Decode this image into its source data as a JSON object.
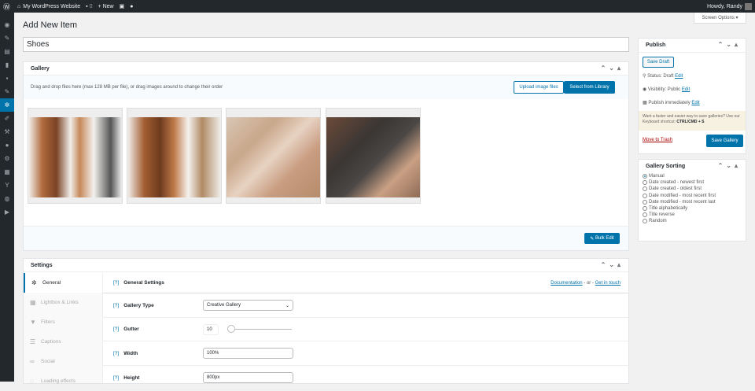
{
  "adminbar": {
    "site_name": "My WordPress Website",
    "comments": "0",
    "new_label": "New",
    "greeting": "Howdy, Randy"
  },
  "screen_options": "Screen Options ▾",
  "page_title": "Add New Item",
  "title_value": "Shoes",
  "gallery": {
    "title": "Gallery",
    "drop_text": "Drag and drop files here (max 128 MB per file), or drag images around to change their order",
    "upload_label": "Upload image files",
    "library_label": "Select from Library",
    "bulk_edit": "Bulk Edit",
    "images": [
      "Brown leather shoes with tools",
      "Brown leather shoes with thread spools",
      "Hands stitching leather",
      "Hands cutting dark leather"
    ]
  },
  "settings": {
    "title": "Settings",
    "tabs": [
      "General",
      "Lightbox & Links",
      "Filters",
      "Captions",
      "Social",
      "Loading effects"
    ],
    "section_title": "General Settings",
    "documentation": "Documentation",
    "or": "- or -",
    "get_in_touch": "Get in touch",
    "help": "[?]",
    "fields": {
      "gallery_type_label": "Gallery Type",
      "gallery_type_value": "Creative Gallery",
      "gutter_label": "Gutter",
      "gutter_value": "10",
      "width_label": "Width",
      "width_value": "100%",
      "height_label": "Height",
      "height_value": "800px"
    }
  },
  "publish": {
    "title": "Publish",
    "save_draft": "Save Draft",
    "status": "Status: Draft",
    "visibility": "Visibility: Public",
    "publish_time": "Publish immediately",
    "edit": "Edit",
    "tip": "Want a faster and easier way to save galleries? Use our Keyboard shortcut:",
    "shortcut": "CTRL/CMD + S",
    "trash": "Move to Trash",
    "save_gallery": "Save Gallery"
  },
  "sorting": {
    "title": "Gallery Sorting",
    "options": [
      "Manual",
      "Date created - newest first",
      "Date created - oldest first",
      "Date modified - most recent first",
      "Date modified - most recent last",
      "Title alphabetically",
      "Title reverse",
      "Random"
    ],
    "selected": 0
  },
  "colors": {
    "accent": "#0073aa",
    "adminbar": "#23282d"
  }
}
